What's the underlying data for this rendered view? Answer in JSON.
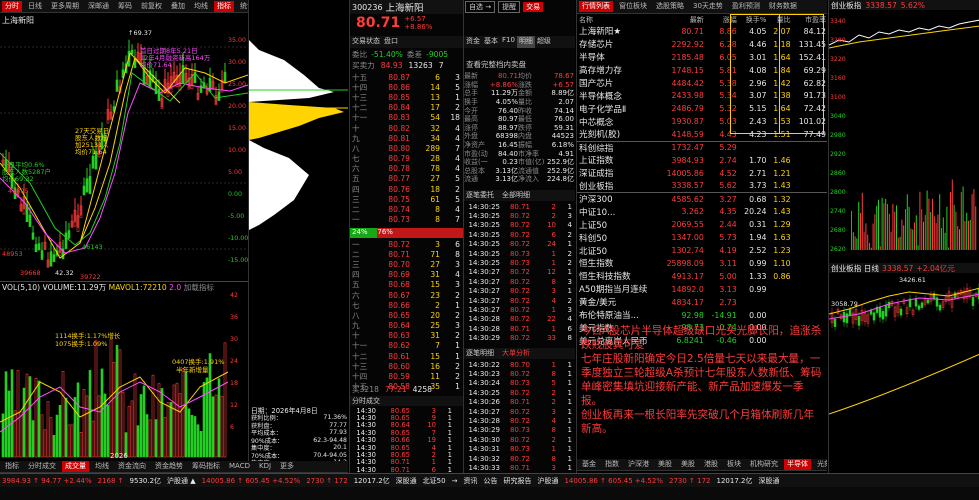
{
  "top_toolbar": {
    "items": [
      "分时",
      "日线",
      "更多周期",
      "",
      "∴",
      "⊕",
      "深邮通",
      "筹码",
      "",
      "前复权",
      "叠加",
      "均线",
      "指标",
      "统计",
      "↔",
      "画线",
      "",
      "⊕",
      "⊟",
      "∧"
    ]
  },
  "chart_header": {
    "mode": "上海新阳",
    "x_tick_mid": "2026"
  },
  "kline_annotations": [
    {
      "text": "↑69.37",
      "cls": "wht"
    },
    {
      "text": "首日过期8年5.21日",
      "cls": "mag"
    },
    {
      "text": "12年4月融资新高164万",
      "cls": "mag"
    },
    {
      "text": "均价71.64",
      "cls": "mag"
    },
    {
      "text": "27天交易日",
      "cls": "yel"
    },
    {
      "text": "股东人数增",
      "cls": "yel"
    },
    {
      "text": "加25131人",
      "cls": "yel"
    },
    {
      "text": "均价71.64",
      "cls": "yel"
    },
    {
      "text": "十日平均0.6%",
      "cls": "grn"
    },
    {
      "text": "股东人数5287户",
      "cls": "grn"
    },
    {
      "text": "均价69.32",
      "cls": "grn"
    },
    {
      "text": "41895",
      "cls": "red"
    },
    {
      "text": "46143",
      "cls": "grn"
    },
    {
      "text": "48953",
      "cls": "red"
    },
    {
      "text": "39668",
      "cls": "red"
    },
    {
      "text": "42.32",
      "cls": "wht"
    },
    {
      "text": "39722",
      "cls": "red"
    }
  ],
  "price_axis": [
    "35.00",
    "30.00",
    "25.00",
    "20.00",
    "15.00",
    "10.00",
    "5.00",
    "0.00",
    "-5.00",
    "-10.00",
    "-15.00"
  ],
  "volume_header": {
    "title": "VOL(5,10)",
    "vol": "VOLUME:11.29万",
    "mavol": "MAVOL1:72210",
    "extra": "2.0",
    "more": "加载指标"
  },
  "volume_annotations": [
    {
      "text": "1114换手:1.17%增长",
      "cls": "yel"
    },
    {
      "text": "1075换手:1.09%",
      "cls": "yel"
    },
    {
      "text": "0407换手:1.91%",
      "cls": "yel"
    },
    {
      "text": "半年新增量",
      "cls": "yel"
    }
  ],
  "vol_axis": [
    "42",
    "36",
    "30",
    "24",
    "18",
    "12",
    "6"
  ],
  "chip_info": {
    "date": "日期：2026年4月8日",
    "rows": [
      [
        "获利比例：",
        "71.36%"
      ],
      [
        "获利盘：",
        "77.77"
      ],
      [
        "平均成本：",
        "77.93"
      ],
      [
        "90%成本：",
        "62.3-94.48"
      ],
      [
        "集中度：",
        "20.1"
      ],
      [
        "70%成本：",
        "70.4-94.05"
      ],
      [
        "集中度：",
        "14.2"
      ]
    ]
  },
  "bottom_tabs": {
    "items": [
      "指标",
      "分时成交",
      "成交量",
      "均线",
      "资金流向",
      "资金趋势",
      "筹码指标",
      "MACD",
      "KDJ",
      "更多"
    ]
  },
  "stock_header": {
    "code": "300236",
    "name": "上海新阳",
    "price": "80.71",
    "change": "+6.57",
    "pct": "+8.86%",
    "btn_self": "自选 →",
    "btn_ask": "提醒",
    "btn_trade": "交易"
  },
  "info_tabs": [
    "交易状态",
    "盘口",
    "资金",
    "基本",
    "F10",
    "明细",
    "超级",
    "更多"
  ],
  "summary": {
    "wb_label": "委比",
    "wb": "-51.40%",
    "wc_label": "委差",
    "wc": "-9005",
    "wm_label": "买卖力",
    "wm": "84.93",
    "wm2": "13263",
    "wm3": "7"
  },
  "asks": [
    [
      "十五",
      "80.87",
      "6",
      "3"
    ],
    [
      "十四",
      "80.86",
      "14",
      "5"
    ],
    [
      "十三",
      "80.85",
      "13",
      "1"
    ],
    [
      "十二",
      "80.84",
      "17",
      "2"
    ],
    [
      "十一",
      "80.83",
      "54",
      "18"
    ],
    [
      "十",
      "80.82",
      "32",
      "4"
    ],
    [
      "九",
      "80.81",
      "34",
      "4"
    ],
    [
      "八",
      "80.80",
      "289",
      "7"
    ],
    [
      "七",
      "80.79",
      "28",
      "4"
    ],
    [
      "六",
      "80.78",
      "78",
      "4"
    ],
    [
      "五",
      "80.77",
      "27",
      "5"
    ],
    [
      "四",
      "80.76",
      "18",
      "2"
    ],
    [
      "三",
      "80.75",
      "61",
      "5"
    ],
    [
      "二",
      "80.74",
      "8",
      "4"
    ],
    [
      "一",
      "80.73",
      "8",
      "7"
    ]
  ],
  "bids": [
    [
      "一",
      "80.72",
      "3",
      "6"
    ],
    [
      "二",
      "80.71",
      "71",
      "8"
    ],
    [
      "三",
      "80.70",
      "27",
      "3"
    ],
    [
      "四",
      "80.69",
      "31",
      "4"
    ],
    [
      "五",
      "80.68",
      "15",
      "3"
    ],
    [
      "六",
      "80.67",
      "23",
      "2"
    ],
    [
      "七",
      "80.66",
      "2",
      "1"
    ],
    [
      "八",
      "80.65",
      "20",
      "2"
    ],
    [
      "九",
      "80.64",
      "25",
      "3"
    ],
    [
      "十",
      "80.63",
      "31",
      "2"
    ],
    [
      "十一",
      "80.62",
      "7",
      "1"
    ],
    [
      "十二",
      "80.61",
      "15",
      "1"
    ],
    [
      "十三",
      "80.60",
      "16",
      "2"
    ],
    [
      "十四",
      "80.59",
      "11",
      "2"
    ],
    [
      "十五",
      "80.58",
      "35",
      "1"
    ]
  ],
  "chip_bar": {
    "left": "24%",
    "right": "76%"
  },
  "bid_footer": {
    "label": "买3218",
    "a": "77.21",
    "b": "4258",
    "c": "6"
  },
  "fin": {
    "link": "查看完整档内卖盘",
    "rows": [
      [
        "最新",
        "80.71",
        "均价",
        "78.67"
      ],
      [
        "涨幅",
        "+8.86%",
        "涨跌",
        "+6.57"
      ],
      [
        "总手",
        "11.29万",
        "金额",
        "8.89亿"
      ],
      [
        "换手",
        "4.05%",
        "量比",
        "2.07"
      ],
      [
        "今开",
        "76.40",
        "昨收",
        "74.14"
      ],
      [
        "最高",
        "80.97",
        "最低",
        "76.00"
      ],
      [
        "涨停",
        "88.97",
        "跌停",
        "59.31"
      ],
      [
        "外盘",
        "68398",
        "内盘",
        "44523"
      ],
      [
        "净资产",
        "16.45",
        "振幅",
        "6.18%"
      ],
      [
        "市盈(动)",
        "84.40",
        "市净率",
        "4.91"
      ],
      [
        "收益(一)",
        "0.23",
        "市值(亿)",
        "252.9亿"
      ],
      [
        "总股本",
        "3.13亿",
        "流通值",
        "252.9亿"
      ],
      [
        "流通",
        "3.13亿",
        "净流入",
        "224.8亿"
      ]
    ]
  },
  "trade_tabs": {
    "t1": "逐笔委托",
    "t2": "全部明细",
    "t3": "逐笔明细",
    "t4": "大单分析"
  },
  "trades_top": [
    [
      "14:30:25",
      "80.71",
      "2",
      "1"
    ],
    [
      "14:30:25",
      "80.72",
      "2",
      "3"
    ],
    [
      "14:30:25",
      "80.72",
      "10",
      "4"
    ],
    [
      "14:30:25",
      "80.72",
      "6",
      "2"
    ],
    [
      "14:30:25",
      "80.72",
      "24",
      "1"
    ],
    [
      "14:30:25",
      "80.73",
      "1",
      "2"
    ],
    [
      "14:30:25",
      "80.73",
      "1",
      "2"
    ],
    [
      "14:30:27",
      "80.72",
      "12",
      "1"
    ],
    [
      "14:30:27",
      "80.72",
      "8",
      "3"
    ],
    [
      "14:30:27",
      "80.72",
      "3",
      "1"
    ],
    [
      "14:30:27",
      "80.72",
      "4",
      "2"
    ],
    [
      "14:30:27",
      "80.72",
      "1",
      "3"
    ],
    [
      "14:30:28",
      "80.72",
      "22",
      "4"
    ],
    [
      "14:30:28",
      "80.71",
      "1",
      "6"
    ],
    [
      "14:30:29",
      "80.72",
      "33",
      "8"
    ]
  ],
  "trades_bottom": [
    [
      "14:30:22",
      "80.70",
      "1",
      "1"
    ],
    [
      "14:30:23",
      "80.72",
      "8",
      "1"
    ],
    [
      "14:30:24",
      "80.73",
      "5",
      "1"
    ],
    [
      "14:30:25",
      "80.72",
      "2",
      "1"
    ],
    [
      "14:30:26",
      "80.71",
      "2",
      "1"
    ],
    [
      "14:30:27",
      "80.72",
      "3",
      "1"
    ],
    [
      "14:30:28",
      "80.72",
      "4",
      "1"
    ],
    [
      "14:30:29",
      "80.73",
      "8",
      "1"
    ],
    [
      "14:30:30",
      "80.72",
      "2",
      "1"
    ],
    [
      "14:30:31",
      "80.73",
      "1",
      "1"
    ],
    [
      "14:30:32",
      "80.72",
      "8",
      "1"
    ],
    [
      "14:30:33",
      "80.71",
      "3",
      "1"
    ]
  ],
  "ticks_left": {
    "title": "分时成交",
    "rows": [
      [
        "14:30",
        "80.65",
        "3",
        "1"
      ],
      [
        "14:30",
        "80.65",
        "9",
        "1"
      ],
      [
        "14:30",
        "80.64",
        "10",
        "1"
      ],
      [
        "14:30",
        "80.65",
        "7",
        "1"
      ],
      [
        "14:30",
        "80.66",
        "19",
        "1"
      ],
      [
        "14:30",
        "80.65",
        "4",
        "1"
      ],
      [
        "14:30",
        "80.65",
        "2",
        "1"
      ],
      [
        "14:30",
        "80.71",
        "1",
        "1"
      ],
      [
        "14:30",
        "80.71",
        "6",
        "1"
      ]
    ]
  },
  "market_tabs": [
    "行情列表",
    "窗位板块",
    "选股策略",
    "30天走势",
    "盈利预测",
    "财务数据"
  ],
  "market_head": [
    "名称",
    "最新",
    "涨幅",
    "换手%",
    "量比",
    "市盈率"
  ],
  "market_rows": [
    [
      "上海新阳★",
      "80.71",
      "8.86",
      "4.05",
      "2.07",
      "84.12",
      "r"
    ],
    [
      "存储芯片",
      "2292.92",
      "6.28",
      "4.46",
      "1.18",
      "131.45",
      "r"
    ],
    [
      "半导体",
      "2185.48",
      "6.05",
      "3.01",
      "1.64",
      "152.41",
      "r"
    ],
    [
      "高存增力存",
      "1748.15",
      "5.81",
      "4.08",
      "1.84",
      "69.29",
      "r"
    ],
    [
      "国产芯片",
      "4484.42",
      "5.38",
      "2.96",
      "1.42",
      "62.82",
      "r"
    ],
    [
      "半导体概念",
      "2433.98",
      "5.34",
      "3.07",
      "1.38",
      "91.73",
      "r"
    ],
    [
      "电子化学品Ⅱ",
      "2486.79",
      "5.32",
      "5.15",
      "1.64",
      "72.42",
      "r"
    ],
    [
      "中芯概念",
      "1930.87",
      "5.03",
      "2.43",
      "1.53",
      "101.02",
      "r"
    ],
    [
      "光刻机(胶)",
      "4148.59",
      "4.43",
      "4.23",
      "1.51",
      "77.49",
      "r"
    ],
    [
      "科创综指",
      "1732.47",
      "5.29",
      "",
      "",
      "",
      "r"
    ],
    [
      "上证指数",
      "3984.93",
      "2.74",
      "1.70",
      "1.46",
      "",
      "r"
    ],
    [
      "深证成指",
      "14005.86",
      "4.52",
      "2.71",
      "1.21",
      "",
      "r"
    ],
    [
      "创业板指",
      "3338.57",
      "5.62",
      "3.73",
      "1.43",
      "",
      "r"
    ],
    [
      "沪深300",
      "4585.62",
      "3.27",
      "0.68",
      "1.32",
      "",
      "r"
    ],
    [
      "中证10...",
      "3.262",
      "4.35",
      "20.24",
      "1.43",
      "",
      "r"
    ],
    [
      "上证50",
      "2069.55",
      "2.44",
      "0.31",
      "1.29",
      "",
      "r"
    ],
    [
      "科创50",
      "1347.00",
      "5.73",
      "1.94",
      "1.63",
      "",
      "r"
    ],
    [
      "北证50",
      "1302.74",
      "4.19",
      "2.52",
      "1.23",
      "",
      "r"
    ],
    [
      "恒生指数",
      "25898.09",
      "3.11",
      "0.99",
      "1.10",
      "",
      "r"
    ],
    [
      "恒生科技指数",
      "4913.17",
      "5.00",
      "1.33",
      "0.86",
      "",
      "r"
    ],
    [
      "A50期指当月连续",
      "14892.0",
      "3.13",
      "0.99",
      "",
      "",
      "r"
    ],
    [
      "黄金/美元",
      "4834.17",
      "2.73",
      "",
      "",
      "",
      "r"
    ],
    [
      "布伦特原油当...",
      "92.98",
      "-14.91",
      "0.00",
      "",
      "",
      "g"
    ],
    [
      "美元指数",
      "98.73",
      "-0.74",
      "0.00",
      "",
      "",
      "g"
    ],
    [
      "美元兑离岸人民币",
      "6.8241",
      "-0.46",
      "0.00",
      "",
      "",
      "g"
    ]
  ],
  "news": {
    "line1": "今日A股芯片半导体超级缺口光头光脚长阳，追涨杀跌贱股真可爱",
    "line2": "七年庄股新阳确定今日2.5倍量七天以来最大量，一季度独立三轮超级A杀预计七年股东人数新低、筹码单峰密集填坑迎接新产能、新产品加速爆发一季报。",
    "line3": "创业板再来一根长阳率先突破几个月箱体刷新几年新高。"
  },
  "sector_tabs": [
    "基金",
    "指数",
    "沪深港",
    "美股",
    "美股",
    "港股",
    "板块",
    "机构研究",
    "半导体",
    "光刻胶",
    "更多",
    "▲",
    "框中机会自..."
  ],
  "mini1": {
    "title": "创业板指",
    "val": "3338.57",
    "pct": "5.62%",
    "axis": [
      "3340",
      "3280",
      "3220",
      "3160",
      "3100",
      "3040",
      "2980",
      "2920",
      "2860",
      "2800",
      "2740",
      "2680",
      "2620"
    ]
  },
  "mini2": {
    "title": "创业板指 日线",
    "val": "3338.57",
    "pct": "+2.04亿元",
    "low": "3058.79",
    "mid": "3426.61"
  },
  "statusbar": {
    "items": [
      "3984.93 ↑ 94.77 +2.44%",
      "2168 ↑",
      "9530.2亿",
      "沪股通 ▲",
      "14005.86 ↑ 605.45 +4.52%",
      "2730 ↑ 172",
      "12017.2亿",
      "深股通",
      "北证50",
      "→",
      "资讯",
      "公告",
      "研究报告",
      "沪股通",
      "14005.86 ↑ 605.45 +4.52%",
      "2730 ↑ 172",
      "12017.2亿",
      "深股通"
    ]
  },
  "colors": {
    "up": "#ff3b3b",
    "down": "#22d022",
    "accent": "#ffd400",
    "bg": "#000000"
  }
}
